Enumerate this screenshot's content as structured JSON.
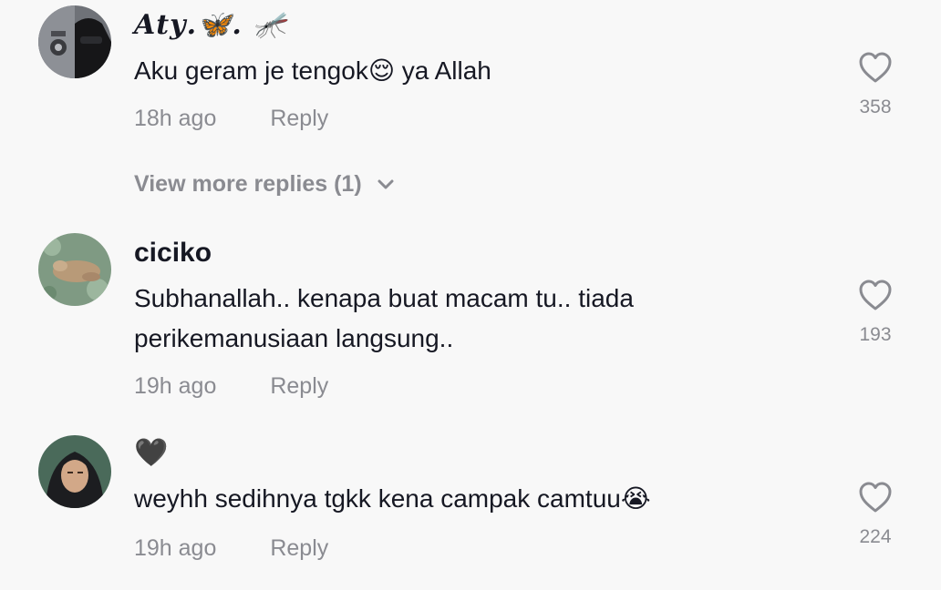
{
  "comments": [
    {
      "username": "𝑨𝒕𝒚.🦋. 🦟",
      "text": "Aku geram je tengok😌 ya Allah",
      "time": "18h ago",
      "reply_label": "Reply",
      "likes": "358"
    },
    {
      "username": "ciciko",
      "text": "Subhanallah.. kenapa buat macam tu.. tiada perikemanusiaan langsung..",
      "time": "19h ago",
      "reply_label": "Reply",
      "likes": "193"
    },
    {
      "username": "🖤",
      "text": "weyhh sedihnya tgkk kena campak camtuu😭",
      "time": "19h ago",
      "reply_label": "Reply",
      "likes": "224"
    }
  ],
  "view_more": {
    "label": "View more replies (1)",
    "icon": "chevron-down-icon"
  },
  "colors": {
    "background": "#f8f8f8",
    "text": "#161823",
    "secondary": "#8a8b91"
  }
}
